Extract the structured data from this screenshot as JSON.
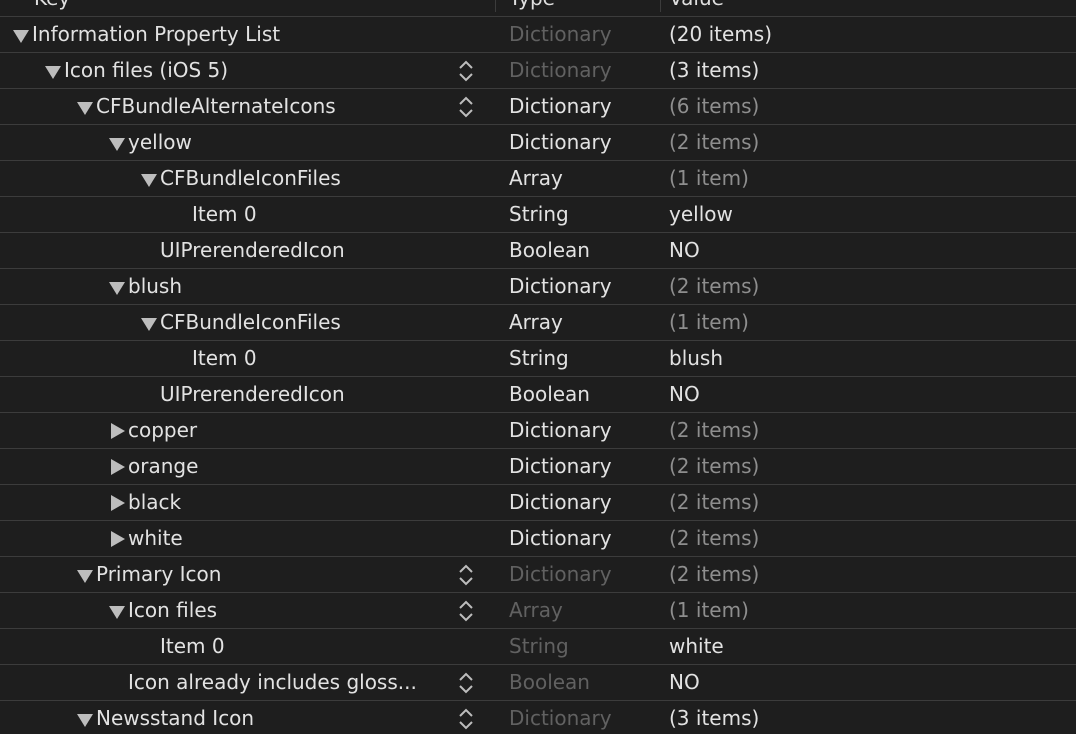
{
  "header": {
    "key_label": "Key",
    "type_label": "Type",
    "value_label": "Value"
  },
  "colors": {
    "background": "#1e1e1e",
    "grid_line": "#3c3c3c",
    "text": "#e2e2e2",
    "dim_type": "#616161",
    "dim_value": "#8e8e8e"
  },
  "rows": [
    {
      "key": "Information Property List",
      "type": "Dictionary",
      "value": "(20 items)",
      "level": 0,
      "disclosure": "expanded",
      "stepper": false,
      "type_dim": true,
      "value_dim": false
    },
    {
      "key": "Icon files (iOS 5)",
      "type": "Dictionary",
      "value": "(3 items)",
      "level": 1,
      "disclosure": "expanded",
      "stepper": true,
      "type_dim": true,
      "value_dim": false
    },
    {
      "key": "CFBundleAlternateIcons",
      "type": "Dictionary",
      "value": "(6 items)",
      "level": 2,
      "disclosure": "expanded",
      "stepper": true,
      "type_dim": false,
      "value_dim": true
    },
    {
      "key": "yellow",
      "type": "Dictionary",
      "value": "(2 items)",
      "level": 3,
      "disclosure": "expanded",
      "stepper": false,
      "type_dim": false,
      "value_dim": true
    },
    {
      "key": "CFBundleIconFiles",
      "type": "Array",
      "value": "(1 item)",
      "level": 4,
      "disclosure": "expanded",
      "stepper": false,
      "type_dim": false,
      "value_dim": true
    },
    {
      "key": "Item 0",
      "type": "String",
      "value": "yellow",
      "level": 5,
      "disclosure": "none",
      "stepper": false,
      "type_dim": false,
      "value_dim": false
    },
    {
      "key": "UIPrerenderedIcon",
      "type": "Boolean",
      "value": "NO",
      "level": 4,
      "disclosure": "none",
      "stepper": false,
      "type_dim": false,
      "value_dim": false
    },
    {
      "key": "blush",
      "type": "Dictionary",
      "value": "(2 items)",
      "level": 3,
      "disclosure": "expanded",
      "stepper": false,
      "type_dim": false,
      "value_dim": true
    },
    {
      "key": "CFBundleIconFiles",
      "type": "Array",
      "value": "(1 item)",
      "level": 4,
      "disclosure": "expanded",
      "stepper": false,
      "type_dim": false,
      "value_dim": true
    },
    {
      "key": "Item 0",
      "type": "String",
      "value": "blush",
      "level": 5,
      "disclosure": "none",
      "stepper": false,
      "type_dim": false,
      "value_dim": false
    },
    {
      "key": "UIPrerenderedIcon",
      "type": "Boolean",
      "value": "NO",
      "level": 4,
      "disclosure": "none",
      "stepper": false,
      "type_dim": false,
      "value_dim": false
    },
    {
      "key": "copper",
      "type": "Dictionary",
      "value": "(2 items)",
      "level": 3,
      "disclosure": "collapsed",
      "stepper": false,
      "type_dim": false,
      "value_dim": true
    },
    {
      "key": "orange",
      "type": "Dictionary",
      "value": "(2 items)",
      "level": 3,
      "disclosure": "collapsed",
      "stepper": false,
      "type_dim": false,
      "value_dim": true
    },
    {
      "key": "black",
      "type": "Dictionary",
      "value": "(2 items)",
      "level": 3,
      "disclosure": "collapsed",
      "stepper": false,
      "type_dim": false,
      "value_dim": true
    },
    {
      "key": "white",
      "type": "Dictionary",
      "value": "(2 items)",
      "level": 3,
      "disclosure": "collapsed",
      "stepper": false,
      "type_dim": false,
      "value_dim": true
    },
    {
      "key": "Primary Icon",
      "type": "Dictionary",
      "value": "(2 items)",
      "level": 2,
      "disclosure": "expanded",
      "stepper": true,
      "type_dim": true,
      "value_dim": true
    },
    {
      "key": "Icon files",
      "type": "Array",
      "value": "(1 item)",
      "level": 3,
      "disclosure": "expanded",
      "stepper": true,
      "type_dim": true,
      "value_dim": true
    },
    {
      "key": "Item 0",
      "type": "String",
      "value": "white",
      "level": 4,
      "disclosure": "none",
      "stepper": false,
      "type_dim": true,
      "value_dim": false
    },
    {
      "key": "Icon already includes gloss...",
      "type": "Boolean",
      "value": "NO",
      "level": 3,
      "disclosure": "none",
      "stepper": true,
      "type_dim": true,
      "value_dim": false
    },
    {
      "key": "Newsstand Icon",
      "type": "Dictionary",
      "value": "(3 items)",
      "level": 2,
      "disclosure": "expanded",
      "stepper": true,
      "type_dim": true,
      "value_dim": false
    }
  ]
}
